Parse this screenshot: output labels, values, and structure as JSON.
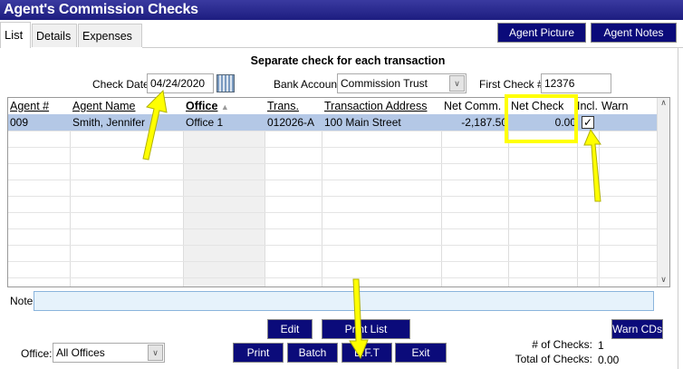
{
  "window": {
    "title": "Agent's Commission Checks"
  },
  "tabs": [
    {
      "label": "List",
      "active": true
    },
    {
      "label": "Details"
    },
    {
      "label": "Expenses"
    }
  ],
  "top_buttons": {
    "agent_picture": "Agent Picture",
    "agent_notes": "Agent Notes"
  },
  "heading": "Separate check for each transaction",
  "form": {
    "check_date_label": "Check Date:",
    "check_date": "04/24/2020",
    "bank_account_label": "Bank Account:",
    "bank_account": "Commission Trust",
    "first_check_label": "First Check #:",
    "first_check": "12376"
  },
  "grid": {
    "columns": [
      "Agent #",
      "Agent Name",
      "Office",
      "Trans.",
      "Transaction Address",
      "Net Comm.",
      "Net Check",
      "Incl.",
      "Warn"
    ],
    "sorted_column": "Office",
    "rows": [
      {
        "agent": "009",
        "name": "Smith, Jennifer",
        "office": "Office 1",
        "trans": "012026-A",
        "address": "100 Main Street",
        "net_comm": "-2,187.50",
        "net_check": "0.00",
        "incl": true,
        "warn": ""
      }
    ]
  },
  "note": {
    "label": "Note:",
    "value": ""
  },
  "buttons": {
    "edit": "Edit",
    "print_list": "Print List",
    "print": "Print",
    "batch": "Batch",
    "eft": "E.F.T",
    "exit": "Exit",
    "warn_cds": "Warn CDs"
  },
  "office_filter": {
    "label": "Office:",
    "value": "All Offices"
  },
  "summary": {
    "num_checks_label": "# of Checks:",
    "num_checks": "1",
    "total_label": "Total of Checks:",
    "total": "0.00"
  },
  "colors": {
    "title_bar": "#1d1d80",
    "button": "#0b0b7a",
    "selected_row": "#b4c8e6",
    "annotation": "#ffff00"
  }
}
